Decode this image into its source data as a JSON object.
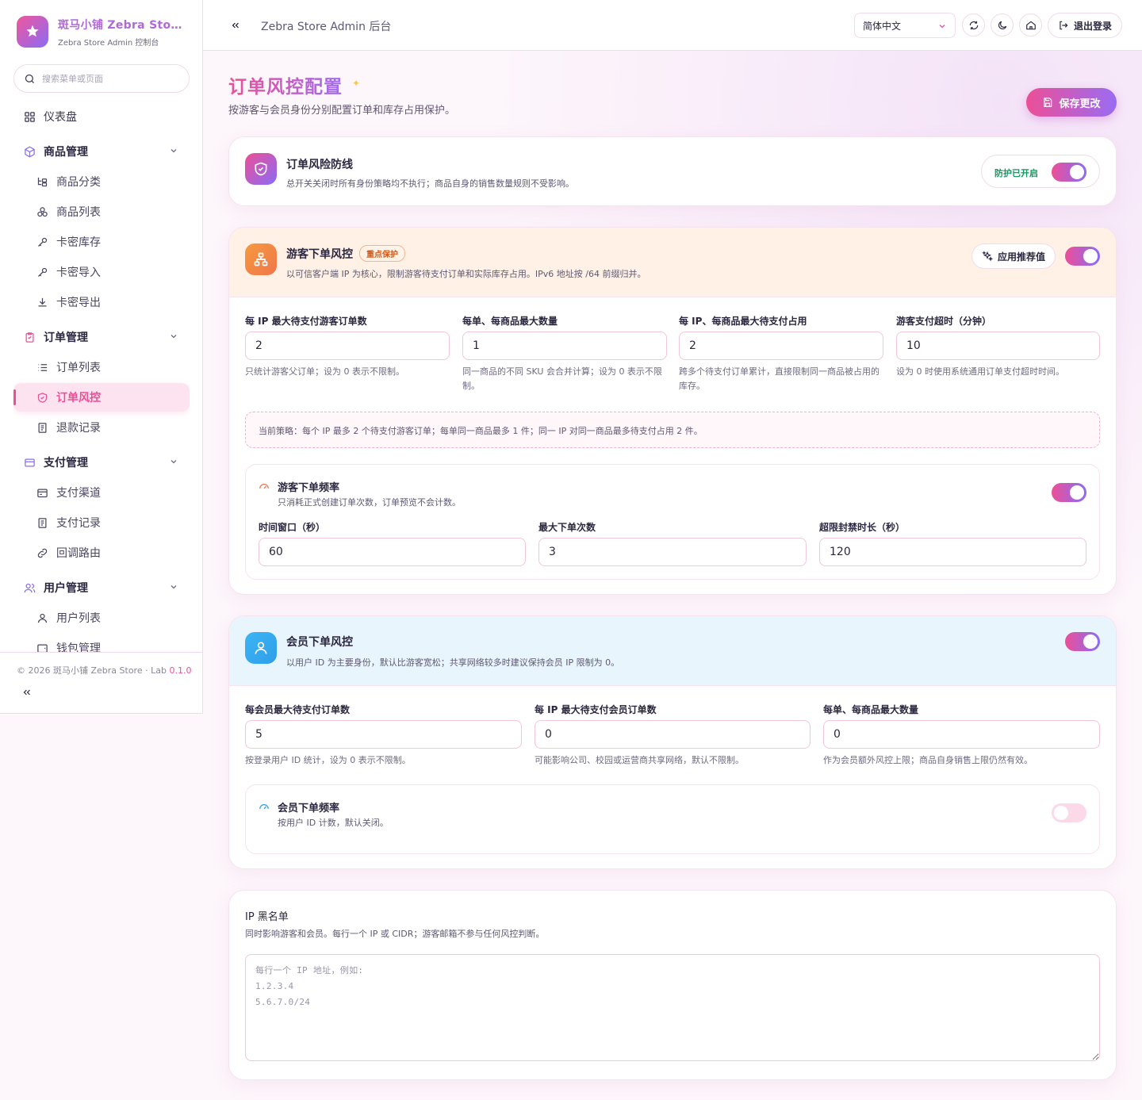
{
  "brand": {
    "title": "斑马小铺 Zebra Store",
    "subtitle": "Zebra Store Admin 控制台"
  },
  "search": {
    "placeholder": "搜索菜单或页面"
  },
  "sidebar": {
    "dashboard": "仪表盘",
    "groups": [
      {
        "label": "商品管理",
        "items": [
          "商品分类",
          "商品列表",
          "卡密库存",
          "卡密导入",
          "卡密导出"
        ]
      },
      {
        "label": "订单管理",
        "items": [
          "订单列表",
          "订单风控",
          "退款记录"
        ]
      },
      {
        "label": "支付管理",
        "items": [
          "支付渠道",
          "支付记录",
          "回调路由"
        ]
      },
      {
        "label": "用户管理",
        "items": [
          "用户列表",
          "钱包管理"
        ]
      }
    ],
    "active_item": "订单风控",
    "copyright": "© 2026 斑马小铺 Zebra Store · Lab ",
    "version": "0.1.0"
  },
  "topbar": {
    "title": "Zebra Store Admin 后台",
    "language": "简体中文",
    "logout": "退出登录"
  },
  "page": {
    "title": "订单风控配置",
    "description": "按游客与会员身份分别配置订单和库存占用保护。",
    "save_button": "保存更改"
  },
  "defense": {
    "title": "订单风险防线",
    "description": "总开关关闭时所有身份策略均不执行；商品自身的销售数量规则不受影响。",
    "status": "防护已开启",
    "enabled": true
  },
  "guest": {
    "title": "游客下单风控",
    "tag": "重点保护",
    "description": "以可信客户端 IP 为核心，限制游客待支付订单和实际库存占用。IPv6 地址按 /64 前缀归并。",
    "apply_button": "应用推荐值",
    "enabled": true,
    "fields": [
      {
        "label": "每 IP 最大待支付游客订单数",
        "value": "2",
        "help": "只统计游客父订单；设为 0 表示不限制。"
      },
      {
        "label": "每单、每商品最大数量",
        "value": "1",
        "help": "同一商品的不同 SKU 会合并计算；设为 0 表示不限制。"
      },
      {
        "label": "每 IP、每商品最大待支付占用",
        "value": "2",
        "help": "跨多个待支付订单累计，直接限制同一商品被占用的库存。"
      },
      {
        "label": "游客支付超时（分钟）",
        "value": "10",
        "help": "设为 0 时使用系统通用订单支付超时时间。"
      }
    ],
    "policy": "当前策略：每个 IP 最多 2 个待支付游客订单；每单同一商品最多 1 件；同一 IP 对同一商品最多待支付占用 2 件。",
    "frequency": {
      "title": "游客下单频率",
      "description": "只消耗正式创建订单次数，订单预览不会计数。",
      "enabled": true,
      "fields": [
        {
          "label": "时间窗口（秒）",
          "value": "60"
        },
        {
          "label": "最大下单次数",
          "value": "3"
        },
        {
          "label": "超限封禁时长（秒）",
          "value": "120"
        }
      ]
    }
  },
  "member": {
    "title": "会员下单风控",
    "description": "以用户 ID 为主要身份，默认比游客宽松；共享网络较多时建议保持会员 IP 限制为 0。",
    "enabled": true,
    "fields": [
      {
        "label": "每会员最大待支付订单数",
        "value": "5",
        "help": "按登录用户 ID 统计，设为 0 表示不限制。"
      },
      {
        "label": "每 IP 最大待支付会员订单数",
        "value": "0",
        "help": "可能影响公司、校园或运营商共享网络，默认不限制。"
      },
      {
        "label": "每单、每商品最大数量",
        "value": "0",
        "help": "作为会员额外风控上限；商品自身销售上限仍然有效。"
      }
    ],
    "frequency": {
      "title": "会员下单频率",
      "description": "按用户 ID 计数，默认关闭。",
      "enabled": false
    }
  },
  "blacklist": {
    "title": "IP 黑名单",
    "description": "同时影响游客和会员。每行一个 IP 或 CIDR；游客邮箱不参与任何风控判断。",
    "placeholder": "每行一个 IP 地址，例如:\n1.2.3.4\n5.6.7.0/24",
    "value": ""
  },
  "colors": {
    "accent_pink": "#ec4f97",
    "accent_purple": "#8a6cf5",
    "guest_section_bg": "#fff1e6",
    "member_section_bg": "#e9f5fd",
    "status_green": "#119a5f"
  }
}
